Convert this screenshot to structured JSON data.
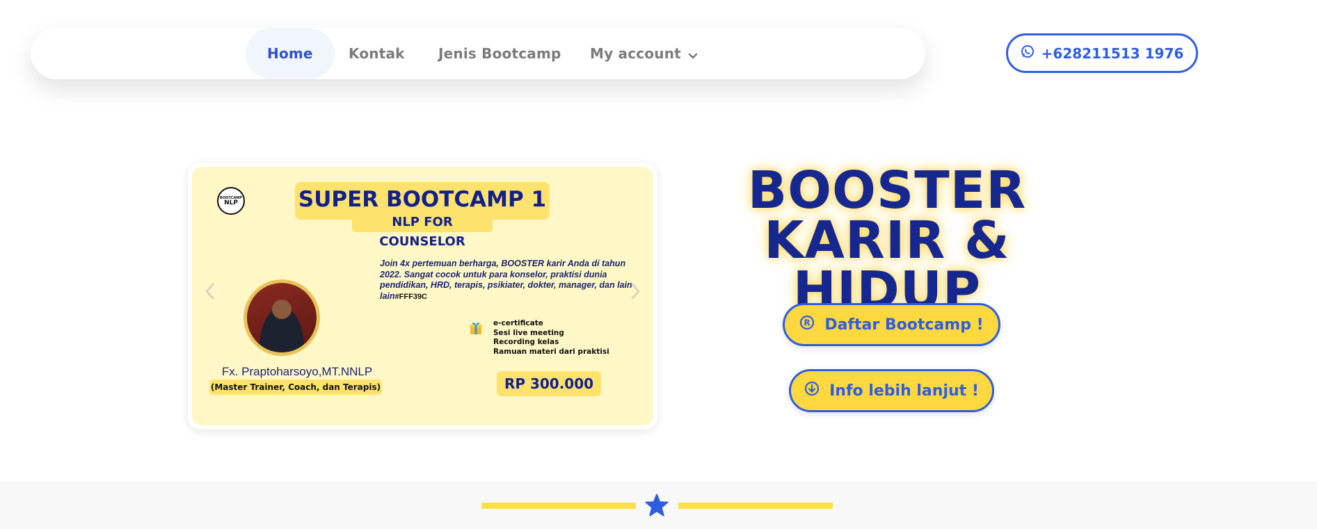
{
  "nav": {
    "items": [
      {
        "label": "Home",
        "active": true
      },
      {
        "label": "Kontak",
        "active": false
      },
      {
        "label": "Jenis Bootcamp",
        "active": false
      },
      {
        "label": "My account",
        "active": false,
        "dropdown": true
      }
    ],
    "whatsapp_label": "+628211513 1976"
  },
  "slide": {
    "logo_small": "BOOTCAMP",
    "logo_main": "NLP",
    "title": "SUPER BOOTCAMP 1",
    "subtitle": "NLP FOR COUNSELOR",
    "description": "Join 4x pertemuan berharga, BOOSTER karir Anda di tahun 2022. Sangat cocok untuk para konselor, praktisi dunia pendidikan, HRD, terapis, psikiater, dokter, manager, dan lain-lain",
    "color_code": "#FFF39C",
    "trainer_name": "Fx. Praptoharsoyo,MT.NNLP",
    "trainer_role": "(Master Trainer, Coach, dan Terapis)",
    "benefits": [
      "e-certificate",
      "Sesi live meeting",
      "Recording kelas",
      "Ramuan materi dari praktisi"
    ],
    "price": "RP 300.000"
  },
  "hero": {
    "title_line1": "BOOSTER",
    "title_line2": "KARIR & HIDUP",
    "register_label": "Daftar Bootcamp !",
    "info_label": "Info lebih lanjut !"
  },
  "colors": {
    "accent_blue": "#2f5de0",
    "navy": "#16288f",
    "yellow": "#fdd83e",
    "card_bg": "#fff8c6"
  },
  "icons": {
    "whatsapp": "whatsapp-icon",
    "register": "registered-icon",
    "info": "download-circle-icon",
    "star": "star-icon",
    "gift": "gift-icon"
  }
}
